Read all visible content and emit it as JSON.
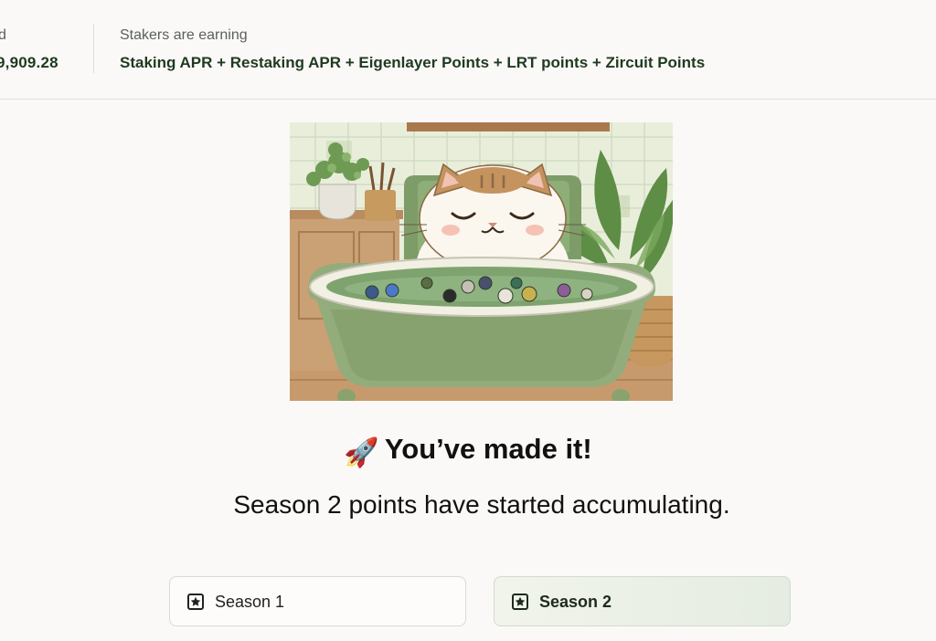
{
  "header": {
    "stat_a": {
      "label": "d",
      "value": "9,909.28"
    },
    "stat_b": {
      "label": "Stakers are earning",
      "value": "Staking APR + Restaking APR + Eigenlayer Points + LRT points + Zircuit Points"
    }
  },
  "hero": {
    "icon": "cat-in-bathtub-illustration"
  },
  "message": {
    "emoji": "🚀",
    "title": "You’ve made it!",
    "subtitle": "Season 2 points have started accumulating."
  },
  "seasons": [
    {
      "label": "Season 1",
      "icon": "star-icon",
      "selected": false
    },
    {
      "label": "Season 2",
      "icon": "star-icon",
      "selected": true
    }
  ],
  "colors": {
    "accent": "#1f3a1f",
    "selected_bg": "#e9efe4",
    "bathtub": "#8fa97a"
  }
}
